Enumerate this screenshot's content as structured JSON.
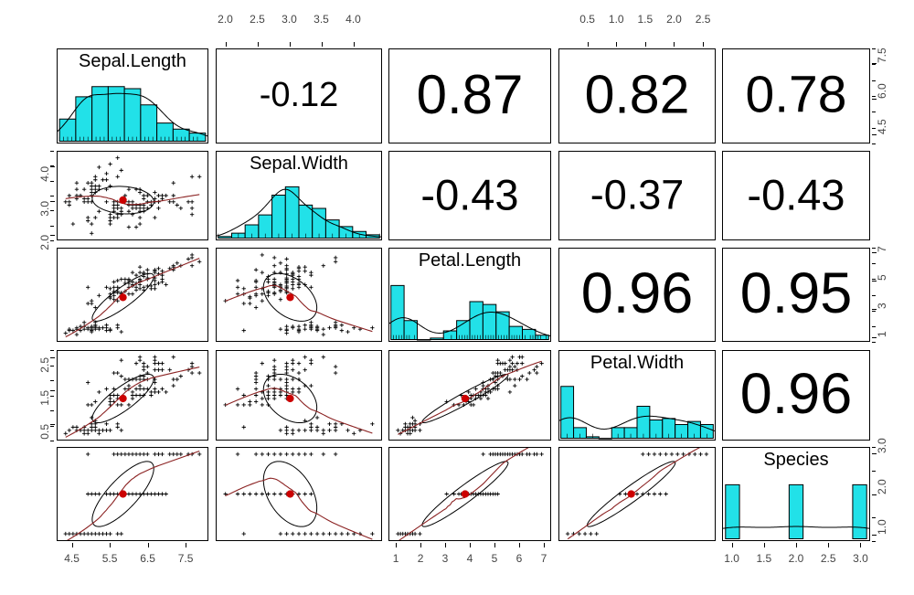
{
  "plot": {
    "type": "scatterplot-matrix",
    "dataset": "iris",
    "style": "pairs.panels",
    "variables": [
      "Sepal.Length",
      "Sepal.Width",
      "Petal.Length",
      "Petal.Width",
      "Species"
    ],
    "colors": {
      "histogram_fill": "#22E1E8",
      "histogram_border": "#000000",
      "density_line": "#000000",
      "loess_line": "#8B2222",
      "centroid_point": "#CC0000",
      "ellipse": "#000000",
      "point": "#000000",
      "panel_border": "#000000",
      "axis_text": "#444444"
    }
  },
  "diagonal": [
    {
      "label": "Sepal.Length",
      "row": 1,
      "col": 1
    },
    {
      "label": "Sepal.Width",
      "row": 2,
      "col": 2
    },
    {
      "label": "Petal.Length",
      "row": 3,
      "col": 3
    },
    {
      "label": "Petal.Width",
      "row": 4,
      "col": 4
    },
    {
      "label": "Species",
      "row": 5,
      "col": 5
    }
  ],
  "correlations": [
    {
      "row": 1,
      "col": 2,
      "x": "Sepal.Length",
      "y": "Sepal.Width",
      "value": "-0.12"
    },
    {
      "row": 1,
      "col": 3,
      "x": "Sepal.Length",
      "y": "Petal.Length",
      "value": "0.87"
    },
    {
      "row": 1,
      "col": 4,
      "x": "Sepal.Length",
      "y": "Petal.Width",
      "value": "0.82"
    },
    {
      "row": 1,
      "col": 5,
      "x": "Sepal.Length",
      "y": "Species",
      "value": "0.78"
    },
    {
      "row": 2,
      "col": 3,
      "x": "Sepal.Width",
      "y": "Petal.Length",
      "value": "-0.43"
    },
    {
      "row": 2,
      "col": 4,
      "x": "Sepal.Width",
      "y": "Petal.Width",
      "value": "-0.37"
    },
    {
      "row": 2,
      "col": 5,
      "x": "Sepal.Width",
      "y": "Species",
      "value": "-0.43"
    },
    {
      "row": 3,
      "col": 4,
      "x": "Petal.Length",
      "y": "Petal.Width",
      "value": "0.96"
    },
    {
      "row": 3,
      "col": 5,
      "x": "Petal.Length",
      "y": "Species",
      "value": "0.95"
    },
    {
      "row": 4,
      "col": 5,
      "x": "Petal.Width",
      "y": "Species",
      "value": "0.96"
    }
  ],
  "axes": {
    "top": [
      {
        "col": 2,
        "var": "Sepal.Width",
        "ticks": [
          "2.0",
          "2.5",
          "3.0",
          "3.5",
          "4.0"
        ],
        "range": [
          1.85,
          4.45
        ]
      },
      {
        "col": 4,
        "var": "Petal.Width",
        "ticks": [
          "0.5",
          "1.0",
          "1.5",
          "2.0",
          "2.5"
        ],
        "range": [
          0.0,
          2.72
        ]
      }
    ],
    "bottom": [
      {
        "col": 1,
        "var": "Sepal.Length",
        "ticks": [
          "4.5",
          "5.5",
          "6.5",
          "7.5"
        ],
        "range": [
          4.1,
          8.1
        ]
      },
      {
        "col": 3,
        "var": "Petal.Length",
        "ticks": [
          "1",
          "2",
          "3",
          "4",
          "5",
          "6",
          "7"
        ],
        "range": [
          0.7,
          7.3
        ]
      },
      {
        "col": 5,
        "var": "Species",
        "ticks": [
          "1.0",
          "1.5",
          "2.0",
          "2.5",
          "3.0"
        ],
        "range": [
          0.85,
          3.15
        ]
      }
    ],
    "left": [
      {
        "row": 2,
        "var": "Sepal.Width",
        "ticks": [
          "2.0",
          "3.0",
          "4.0"
        ],
        "range": [
          1.85,
          4.45
        ]
      },
      {
        "row": 4,
        "var": "Petal.Width",
        "ticks": [
          "0.5",
          "1.5",
          "2.5"
        ],
        "range": [
          0.0,
          2.72
        ]
      }
    ],
    "right": [
      {
        "row": 1,
        "var": "Sepal.Length",
        "ticks": [
          "4.5",
          "6.0",
          "7.5"
        ],
        "range": [
          4.1,
          8.1
        ]
      },
      {
        "row": 3,
        "var": "Petal.Length",
        "ticks": [
          "1",
          "3",
          "5",
          "7"
        ],
        "range": [
          0.7,
          7.3
        ]
      },
      {
        "row": 5,
        "var": "Species",
        "ticks": [
          "1.0",
          "2.0",
          "3.0"
        ],
        "range": [
          0.85,
          3.15
        ]
      }
    ]
  },
  "chart_data": {
    "type": "scatter",
    "title": "",
    "xlabel": "",
    "ylabel": "",
    "variables": [
      "Sepal.Length",
      "Sepal.Width",
      "Petal.Length",
      "Petal.Width",
      "Species"
    ],
    "correlation_matrix": [
      [
        1.0,
        -0.12,
        0.87,
        0.82,
        0.78
      ],
      [
        -0.12,
        1.0,
        -0.43,
        -0.37,
        -0.43
      ],
      [
        0.87,
        -0.43,
        1.0,
        0.96,
        0.95
      ],
      [
        0.82,
        -0.37,
        0.96,
        1.0,
        0.96
      ],
      [
        0.78,
        -0.43,
        0.95,
        0.96,
        1.0
      ]
    ],
    "means": [
      5.843,
      3.057,
      3.758,
      1.199,
      2.0
    ],
    "ranges": {
      "Sepal.Length": [
        4.3,
        7.9
      ],
      "Sepal.Width": [
        2.0,
        4.4
      ],
      "Petal.Length": [
        1.0,
        6.9
      ],
      "Petal.Width": [
        0.1,
        2.5
      ],
      "Species": [
        1,
        3
      ]
    },
    "histograms": {
      "Sepal.Length": {
        "bins": [
          4.3,
          4.7,
          5.1,
          5.5,
          5.9,
          6.3,
          6.7,
          7.1,
          7.5,
          7.9
        ],
        "counts": [
          11,
          22,
          27,
          27,
          26,
          18,
          9,
          6,
          4
        ]
      },
      "Sepal.Width": {
        "bins": [
          2.0,
          2.2,
          2.4,
          2.6,
          2.8,
          3.0,
          3.2,
          3.4,
          3.6,
          3.8,
          4.0,
          4.2,
          4.4
        ],
        "counts": [
          1,
          3,
          8,
          14,
          26,
          31,
          20,
          18,
          11,
          7,
          4,
          2
        ]
      },
      "Petal.Length": {
        "bins": [
          1.0,
          1.5,
          2.0,
          2.5,
          3.0,
          3.5,
          4.0,
          4.5,
          5.0,
          5.5,
          6.0,
          6.5,
          7.0
        ],
        "counts": [
          37,
          13,
          0,
          1,
          6,
          13,
          26,
          24,
          19,
          9,
          7,
          3
        ]
      },
      "Petal.Width": {
        "bins": [
          0.1,
          0.3,
          0.5,
          0.7,
          0.9,
          1.1,
          1.3,
          1.5,
          1.7,
          1.9,
          2.1,
          2.3,
          2.5
        ],
        "counts": [
          34,
          7,
          1,
          0,
          7,
          7,
          21,
          12,
          13,
          9,
          11,
          9
        ]
      },
      "Species": {
        "bins": [
          1,
          2,
          3
        ],
        "counts": [
          50,
          50,
          50
        ]
      }
    },
    "data": {
      "Sepal.Length": [
        5.1,
        4.9,
        4.7,
        4.6,
        5.0,
        5.4,
        4.6,
        5.0,
        4.4,
        4.9,
        5.4,
        4.8,
        4.8,
        4.3,
        5.8,
        5.7,
        5.4,
        5.1,
        5.7,
        5.1,
        5.4,
        5.1,
        4.6,
        5.1,
        4.8,
        5.0,
        5.0,
        5.2,
        5.2,
        4.7,
        4.8,
        5.4,
        5.2,
        5.5,
        4.9,
        5.0,
        5.5,
        4.9,
        4.4,
        5.1,
        5.0,
        4.5,
        4.4,
        5.0,
        5.1,
        4.8,
        5.1,
        4.6,
        5.3,
        5.0,
        7.0,
        6.4,
        6.9,
        5.5,
        6.5,
        5.7,
        6.3,
        4.9,
        6.6,
        5.2,
        5.0,
        5.9,
        6.0,
        6.1,
        5.6,
        6.7,
        5.6,
        5.8,
        6.2,
        5.6,
        5.9,
        6.1,
        6.3,
        6.1,
        6.4,
        6.6,
        6.8,
        6.7,
        6.0,
        5.7,
        5.5,
        5.5,
        5.8,
        6.0,
        5.4,
        6.0,
        6.7,
        6.3,
        5.6,
        5.5,
        5.5,
        6.1,
        5.8,
        5.0,
        5.6,
        5.7,
        5.7,
        6.2,
        5.1,
        5.7,
        6.3,
        5.8,
        7.1,
        6.3,
        6.5,
        7.6,
        4.9,
        7.3,
        6.7,
        7.2,
        6.5,
        6.4,
        6.8,
        5.7,
        5.8,
        6.4,
        6.5,
        7.7,
        7.7,
        6.0,
        6.9,
        5.6,
        7.7,
        6.3,
        6.7,
        7.2,
        6.2,
        6.1,
        6.4,
        7.2,
        7.4,
        7.9,
        6.4,
        6.3,
        6.1,
        7.7,
        6.3,
        6.4,
        6.0,
        6.9,
        6.7,
        6.9,
        5.8,
        6.8,
        6.7,
        6.7,
        6.3,
        6.5,
        6.2,
        5.9
      ],
      "Sepal.Width": [
        3.5,
        3.0,
        3.2,
        3.1,
        3.6,
        3.9,
        3.4,
        3.4,
        2.9,
        3.1,
        3.7,
        3.4,
        3.0,
        3.0,
        4.0,
        4.4,
        3.9,
        3.5,
        3.8,
        3.8,
        3.4,
        3.7,
        3.6,
        3.3,
        3.4,
        3.0,
        3.4,
        3.5,
        3.4,
        3.2,
        3.1,
        3.4,
        4.1,
        4.2,
        3.1,
        3.2,
        3.5,
        3.6,
        3.0,
        3.4,
        3.5,
        2.3,
        3.2,
        3.5,
        3.8,
        3.0,
        3.8,
        3.2,
        3.7,
        3.3,
        3.2,
        3.2,
        3.1,
        2.3,
        2.8,
        2.8,
        3.3,
        2.4,
        2.9,
        2.7,
        2.0,
        3.0,
        2.2,
        2.9,
        2.9,
        3.1,
        3.0,
        2.7,
        2.2,
        2.5,
        3.2,
        2.8,
        2.5,
        2.8,
        2.9,
        3.0,
        2.8,
        3.0,
        2.9,
        2.6,
        2.4,
        2.4,
        2.7,
        2.7,
        3.0,
        3.4,
        3.1,
        2.3,
        3.0,
        2.5,
        2.6,
        3.0,
        2.6,
        2.3,
        2.7,
        3.0,
        2.9,
        2.9,
        2.5,
        2.8,
        3.3,
        2.7,
        3.0,
        2.9,
        3.0,
        3.0,
        2.5,
        2.9,
        2.5,
        3.6,
        3.2,
        2.7,
        3.0,
        2.5,
        2.8,
        3.2,
        3.0,
        3.8,
        2.6,
        2.2,
        3.2,
        2.8,
        2.8,
        2.7,
        3.3,
        3.2,
        2.8,
        3.0,
        2.8,
        3.0,
        2.8,
        3.8,
        2.8,
        2.8,
        2.6,
        3.0,
        3.4,
        3.1,
        3.0,
        3.1,
        3.1,
        3.1,
        2.7,
        3.2,
        3.3,
        3.0,
        2.5,
        3.0,
        3.4,
        3.0
      ],
      "Petal.Length": [
        1.4,
        1.4,
        1.3,
        1.5,
        1.4,
        1.7,
        1.4,
        1.5,
        1.4,
        1.5,
        1.5,
        1.6,
        1.4,
        1.1,
        1.2,
        1.5,
        1.3,
        1.4,
        1.7,
        1.5,
        1.7,
        1.5,
        1.0,
        1.7,
        1.9,
        1.6,
        1.6,
        1.5,
        1.4,
        1.6,
        1.6,
        1.5,
        1.5,
        1.4,
        1.5,
        1.2,
        1.3,
        1.4,
        1.3,
        1.5,
        1.3,
        1.3,
        1.3,
        1.6,
        1.9,
        1.4,
        1.6,
        1.4,
        1.5,
        1.4,
        4.7,
        4.5,
        4.9,
        4.0,
        4.6,
        4.5,
        4.7,
        3.3,
        4.6,
        3.9,
        3.5,
        4.2,
        4.0,
        4.7,
        3.6,
        4.4,
        4.5,
        4.1,
        4.5,
        3.9,
        4.8,
        4.0,
        4.9,
        4.7,
        4.3,
        4.4,
        4.8,
        5.0,
        4.5,
        3.5,
        3.8,
        3.7,
        3.9,
        5.1,
        4.5,
        4.5,
        4.7,
        4.4,
        4.1,
        4.0,
        4.4,
        4.6,
        4.0,
        3.3,
        4.2,
        4.2,
        4.2,
        4.3,
        3.0,
        4.1,
        6.0,
        5.1,
        5.9,
        5.6,
        5.8,
        6.6,
        4.5,
        6.3,
        5.8,
        6.1,
        5.1,
        5.3,
        5.5,
        5.0,
        5.1,
        5.3,
        5.5,
        6.7,
        6.9,
        5.0,
        5.7,
        4.9,
        6.7,
        4.9,
        5.7,
        6.0,
        4.8,
        4.9,
        5.6,
        5.8,
        6.1,
        6.4,
        5.6,
        5.1,
        5.6,
        6.1,
        5.6,
        5.5,
        4.8,
        5.4,
        5.6,
        5.1,
        5.1,
        5.9,
        5.7,
        5.2,
        5.0,
        5.2,
        5.4,
        5.1
      ],
      "Petal.Width": [
        0.2,
        0.2,
        0.2,
        0.2,
        0.2,
        0.4,
        0.3,
        0.2,
        0.2,
        0.1,
        0.2,
        0.2,
        0.1,
        0.1,
        0.2,
        0.4,
        0.4,
        0.3,
        0.3,
        0.3,
        0.2,
        0.4,
        0.2,
        0.5,
        0.2,
        0.2,
        0.4,
        0.2,
        0.2,
        0.2,
        0.2,
        0.4,
        0.1,
        0.2,
        0.2,
        0.2,
        0.2,
        0.1,
        0.2,
        0.2,
        0.3,
        0.3,
        0.2,
        0.6,
        0.4,
        0.3,
        0.2,
        0.2,
        0.2,
        0.2,
        1.4,
        1.5,
        1.5,
        1.3,
        1.5,
        1.3,
        1.6,
        1.0,
        1.3,
        1.4,
        1.0,
        1.5,
        1.0,
        1.4,
        1.3,
        1.4,
        1.5,
        1.0,
        1.5,
        1.1,
        1.8,
        1.3,
        1.5,
        1.2,
        1.3,
        1.4,
        1.4,
        1.7,
        1.5,
        1.0,
        1.1,
        1.0,
        1.2,
        1.6,
        1.5,
        1.6,
        1.5,
        1.3,
        1.3,
        1.3,
        1.2,
        1.4,
        1.2,
        1.0,
        1.3,
        1.2,
        1.3,
        1.3,
        1.1,
        1.3,
        2.5,
        1.9,
        2.1,
        1.8,
        2.2,
        2.1,
        1.7,
        1.8,
        1.8,
        2.5,
        2.0,
        1.9,
        2.1,
        2.0,
        2.4,
        2.3,
        1.8,
        2.2,
        2.3,
        1.5,
        2.3,
        2.0,
        2.0,
        1.8,
        2.1,
        1.8,
        1.8,
        1.8,
        2.1,
        1.6,
        1.9,
        2.0,
        2.2,
        1.5,
        1.4,
        2.3,
        2.4,
        1.8,
        1.8,
        2.1,
        2.4,
        2.3,
        1.9,
        2.3,
        2.5,
        2.3,
        1.9,
        2.0,
        2.3,
        1.8
      ],
      "Species": [
        1,
        1,
        1,
        1,
        1,
        1,
        1,
        1,
        1,
        1,
        1,
        1,
        1,
        1,
        1,
        1,
        1,
        1,
        1,
        1,
        1,
        1,
        1,
        1,
        1,
        1,
        1,
        1,
        1,
        1,
        1,
        1,
        1,
        1,
        1,
        1,
        1,
        1,
        1,
        1,
        1,
        1,
        1,
        1,
        1,
        1,
        1,
        1,
        1,
        1,
        2,
        2,
        2,
        2,
        2,
        2,
        2,
        2,
        2,
        2,
        2,
        2,
        2,
        2,
        2,
        2,
        2,
        2,
        2,
        2,
        2,
        2,
        2,
        2,
        2,
        2,
        2,
        2,
        2,
        2,
        2,
        2,
        2,
        2,
        2,
        2,
        2,
        2,
        2,
        2,
        2,
        2,
        2,
        2,
        2,
        2,
        2,
        2,
        2,
        2,
        3,
        3,
        3,
        3,
        3,
        3,
        3,
        3,
        3,
        3,
        3,
        3,
        3,
        3,
        3,
        3,
        3,
        3,
        3,
        3,
        3,
        3,
        3,
        3,
        3,
        3,
        3,
        3,
        3,
        3,
        3,
        3,
        3,
        3,
        3,
        3,
        3,
        3,
        3,
        3,
        3,
        3,
        3,
        3,
        3,
        3,
        3,
        3,
        3,
        3
      ]
    }
  }
}
